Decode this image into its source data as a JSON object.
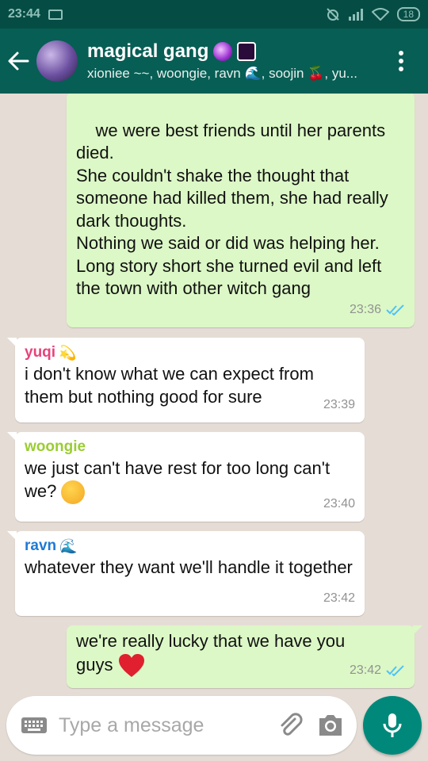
{
  "status_bar": {
    "time": "23:44",
    "battery": "18"
  },
  "header": {
    "title": "magical gang",
    "members": "xioniee ~~, woongie, ravn 🌊, soojin 🍒, yu..."
  },
  "messages": [
    {
      "direction": "outgoing",
      "text": "we were best friends until her parents died.\nShe couldn't shake the thought that someone had killed them, she had really dark thoughts.\nNothing we said or did was helping her.\nLong story short she turned evil and left the town with other witch gang",
      "time": "23:36",
      "read": true
    },
    {
      "direction": "incoming",
      "sender": "yuqi",
      "sender_color": "#e8437a",
      "text": "i don't know what we can expect from them but nothing good for sure",
      "time": "23:39"
    },
    {
      "direction": "incoming",
      "sender": "woongie",
      "sender_color": "#9acd32",
      "text": "we just can't have rest for too long can't we?",
      "time": "23:40"
    },
    {
      "direction": "incoming",
      "sender": "ravn",
      "sender_color": "#1e7ad6",
      "text": "whatever they want we'll handle it together",
      "time": "23:42"
    },
    {
      "direction": "outgoing",
      "text": "we're really lucky that we have you guys",
      "time": "23:42",
      "read": true
    }
  ],
  "composer": {
    "placeholder": "Type a message"
  },
  "icons": {
    "back": "arrow-left-icon",
    "menu": "more-vert-icon",
    "keyboard": "keyboard-icon",
    "attach": "paperclip-icon",
    "camera": "camera-icon",
    "mic": "microphone-icon"
  },
  "colors": {
    "header": "#075e54",
    "status_bar": "#054d44",
    "outgoing_bubble": "#dcf8c6",
    "incoming_bubble": "#ffffff",
    "chat_background": "#e5ddd5",
    "mic_button": "#00897b",
    "read_tick": "#4fc3f7"
  }
}
